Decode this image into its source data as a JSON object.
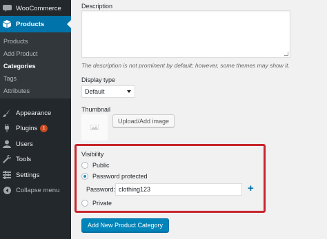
{
  "sidebar": {
    "woocommerce": {
      "label": "WooCommerce",
      "icon": "woocommerce-icon"
    },
    "products": {
      "label": "Products",
      "icon": "products-box-icon"
    },
    "submenu": [
      {
        "label": "Products"
      },
      {
        "label": "Add Product"
      },
      {
        "label": "Categories",
        "current": true
      },
      {
        "label": "Tags"
      },
      {
        "label": "Attributes"
      }
    ],
    "appearance": {
      "label": "Appearance",
      "icon": "paintbrush-icon"
    },
    "plugins": {
      "label": "Plugins",
      "icon": "plug-icon",
      "badge": "1"
    },
    "users": {
      "label": "Users",
      "icon": "user-icon"
    },
    "tools": {
      "label": "Tools",
      "icon": "wrench-icon"
    },
    "settings": {
      "label": "Settings",
      "icon": "settings-sliders-icon"
    },
    "collapse": {
      "label": "Collapse menu",
      "icon": "collapse-arrow-icon"
    }
  },
  "form": {
    "description_label": "Description",
    "description_value": "",
    "description_hint": "The description is not prominent by default; however, some themes may show it.",
    "display_type_label": "Display type",
    "display_type_value": "Default",
    "thumbnail_label": "Thumbnail",
    "upload_button": "Upload/Add image",
    "visibility": {
      "label": "Visibility",
      "options": [
        {
          "label": "Public",
          "checked": false
        },
        {
          "label": "Password protected",
          "checked": true
        },
        {
          "label": "Private",
          "checked": false
        }
      ],
      "password_label": "Password:",
      "password_value": "clothing123"
    },
    "submit_button": "Add New Product Category"
  },
  "colors": {
    "sidebar_bg": "#23282d",
    "active_menu": "#0073aa",
    "highlight_border": "#c7252d",
    "primary_button": "#0085ba"
  }
}
